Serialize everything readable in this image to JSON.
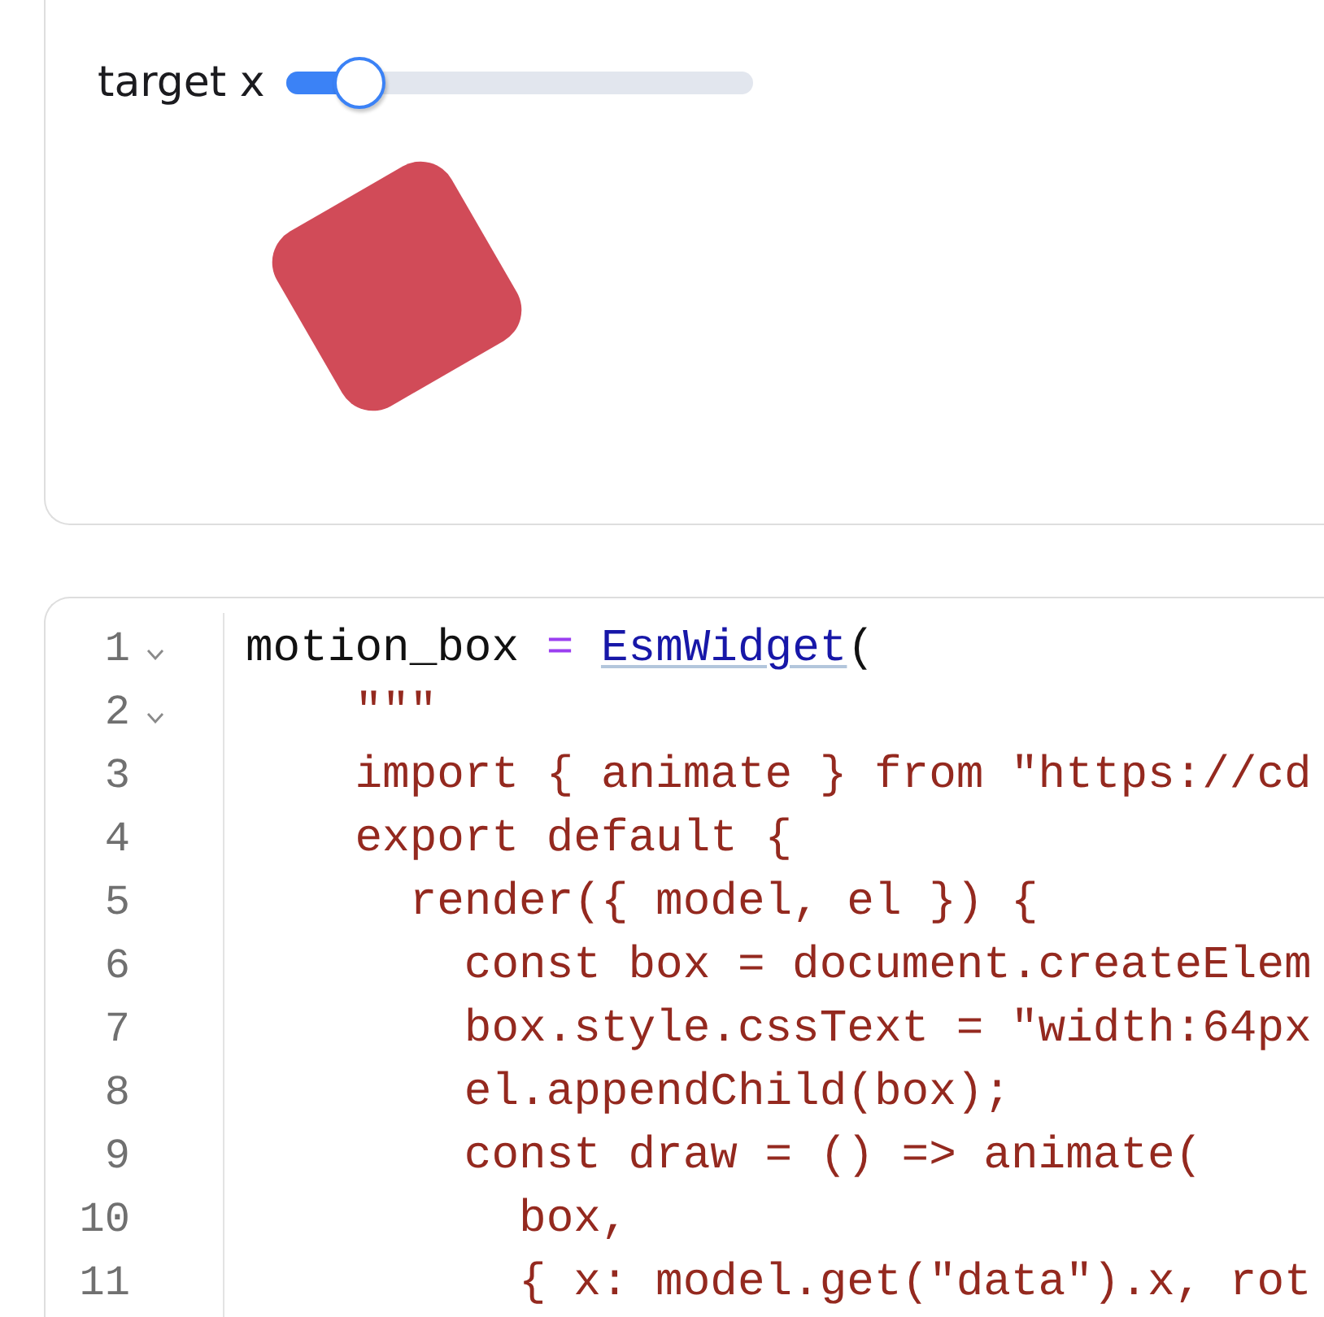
{
  "widget_output": {
    "slider": {
      "label": "target x",
      "level": 0.157
    }
  },
  "code_cell": {
    "lines": [
      {
        "number": "1",
        "foldable": true,
        "tokens": [
          {
            "kind": "plain",
            "text": "motion_box "
          },
          {
            "kind": "operator",
            "text": "= "
          },
          {
            "kind": "link",
            "text": "EsmWidget"
          },
          {
            "kind": "plain",
            "text": "("
          }
        ]
      },
      {
        "number": "2",
        "foldable": true,
        "tokens": [
          {
            "kind": "string",
            "text": "    \"\"\""
          }
        ]
      },
      {
        "number": "3",
        "foldable": false,
        "tokens": [
          {
            "kind": "string",
            "text": "    import { animate } from \"https://cd"
          }
        ]
      },
      {
        "number": "4",
        "foldable": false,
        "tokens": [
          {
            "kind": "string",
            "text": "    export default {"
          }
        ]
      },
      {
        "number": "5",
        "foldable": false,
        "tokens": [
          {
            "kind": "string",
            "text": "      render({ model, el }) {"
          }
        ]
      },
      {
        "number": "6",
        "foldable": false,
        "tokens": [
          {
            "kind": "string",
            "text": "        const box = document.createElem"
          }
        ]
      },
      {
        "number": "7",
        "foldable": false,
        "tokens": [
          {
            "kind": "string",
            "text": "        box.style.cssText = \"width:64px"
          }
        ]
      },
      {
        "number": "8",
        "foldable": false,
        "tokens": [
          {
            "kind": "string",
            "text": "        el.appendChild(box);"
          }
        ]
      },
      {
        "number": "9",
        "foldable": false,
        "tokens": [
          {
            "kind": "string",
            "text": "        const draw = () => animate("
          }
        ]
      },
      {
        "number": "10",
        "foldable": false,
        "tokens": [
          {
            "kind": "string",
            "text": "          box,"
          }
        ]
      },
      {
        "number": "11",
        "foldable": false,
        "tokens": [
          {
            "kind": "string",
            "text": "          { x: model.get(\"data\").x, rot"
          }
        ]
      }
    ]
  }
}
